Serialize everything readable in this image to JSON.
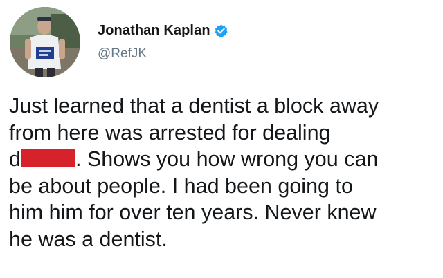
{
  "author": {
    "display_name": "Jonathan Kaplan",
    "handle": "@RefJK",
    "avatar_icon": "profile-photo",
    "verified_icon": "verified-badge-icon",
    "verified_color": "#1da1f2"
  },
  "tweet": {
    "lines": [
      "Just learned that a dentist a block away",
      "from here was arrested for dealing",
      "d",
      ". Shows you how wrong you can",
      "be about people. I had been going to",
      "him him for over ten years. Never knew",
      "he was a dentist."
    ],
    "redaction_color": "#d6222b"
  }
}
